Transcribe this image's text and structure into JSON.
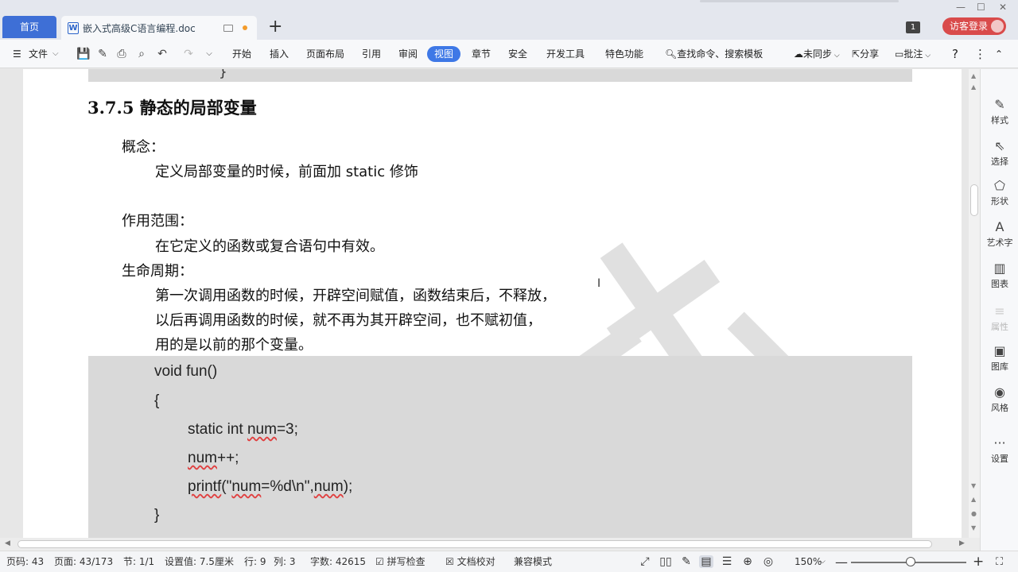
{
  "tabs": {
    "home_label": "首页",
    "doc_title": "嵌入式高级C语言编程.doc",
    "new_tab": "+"
  },
  "window": {
    "badge": "1",
    "guest_login": "访客登录"
  },
  "ribbon": {
    "file_menu": "文件",
    "tabs": [
      "开始",
      "插入",
      "页面布局",
      "引用",
      "审阅",
      "视图",
      "章节",
      "安全",
      "开发工具",
      "特色功能"
    ],
    "active_tab": "视图",
    "search": "查找命令、搜索模板",
    "sync": "未同步",
    "share": "分享",
    "comment": "批注",
    "help": "?"
  },
  "document": {
    "top_code_brace": "}",
    "heading": "3.7.5  静态的局部变量",
    "concept_label": "概念：",
    "concept_text": "定义局部变量的时候，前面加 static  修饰",
    "scope_label": "作用范围：",
    "scope_text": "在它定义的函数或复合语句中有效。",
    "life_label": "生命周期：",
    "life_lines": [
      "第一次调用函数的时候，开辟空间赋值，函数结束后，不释放，",
      "以后再调用函数的时候，就不再为其开辟空间，也不赋初值，",
      "用的是以前的那个变量。"
    ],
    "code": {
      "line1": "void fun()",
      "line2": "{",
      "line3_pre": "static int ",
      "line3_var": "num",
      "line3_post": "=3;",
      "line4_var": "num",
      "line4_post": "++;",
      "line5_fn": "printf",
      "line5_mid1": "(\"",
      "line5_var1": "num",
      "line5_mid2": "=%d\\n\",",
      "line5_var2": "num",
      "line5_end": ");",
      "line6": "}"
    }
  },
  "right_panel": {
    "items": [
      "样式",
      "选择",
      "形状",
      "艺术字",
      "图表",
      "属性",
      "图库",
      "风格",
      "设置"
    ]
  },
  "status_bar": {
    "page_code": "页码: 43",
    "page": "页面: 43/173",
    "section": "节: 1/1",
    "setting": "设置值: 7.5厘米",
    "row": "行: 9",
    "col": "列: 3",
    "word_count": "字数: 42615",
    "spell_check": "拼写检查",
    "doc_proof": "文档校对",
    "compat_mode": "兼容模式",
    "zoom": "150%",
    "zoom_fraction": 0.52
  },
  "colors": {
    "accent": "#3e78e6",
    "guest": "#d94b4b",
    "code_bg": "#d9d9d9"
  }
}
